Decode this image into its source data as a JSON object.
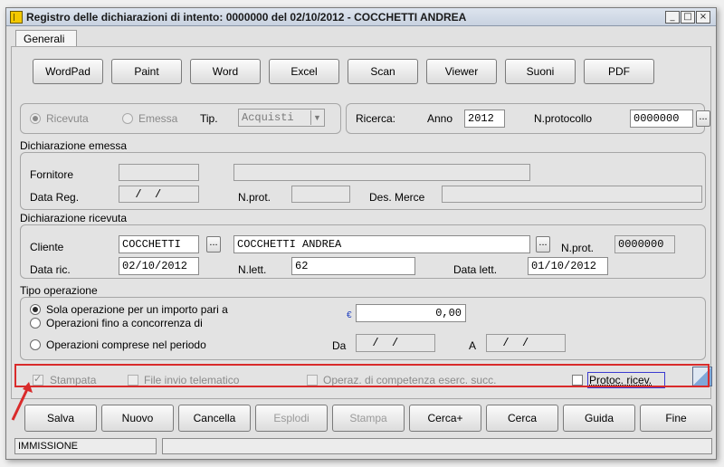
{
  "window": {
    "title": "Registro delle dichiarazioni di intento:  0000000 del 02/10/2012 - COCCHETTI ANDREA",
    "minimize": "_",
    "maximize": "□",
    "close": "×"
  },
  "tabs": [
    "Generali"
  ],
  "toolbar": {
    "buttons": [
      "WordPad",
      "Paint",
      "Word",
      "Excel",
      "Scan",
      "Viewer",
      "Suoni",
      "PDF"
    ]
  },
  "type_section": {
    "ricevuta_label": "Ricevuta",
    "emessa_label": "Emessa",
    "tip_label": "Tip.",
    "tip_value": "Acquisti",
    "ricevuta_selected": true
  },
  "search": {
    "label": "Ricerca:",
    "anno_label": "Anno",
    "anno_value": "2012",
    "protocollo_label": "N.protocollo",
    "protocollo_value": "0000000",
    "browse": "..."
  },
  "emessa": {
    "heading": "Dichiarazione emessa",
    "fornitore_label": "Fornitore",
    "fornitore_code": "",
    "fornitore_name": "",
    "data_reg_label": "Data Reg.",
    "data_reg_value": "  /  /",
    "nprot_label": "N.prot.",
    "nprot_value": "",
    "des_merce_label": "Des. Merce",
    "des_merce_value": ""
  },
  "ricevuta": {
    "heading": "Dichiarazione ricevuta",
    "cliente_label": "Cliente",
    "cliente_code": "COCCHETTI",
    "cliente_name": "COCCHETTI ANDREA",
    "browse": "...",
    "nprot_label": "N.prot.",
    "nprot_value": "0000000",
    "data_ric_label": "Data ric.",
    "data_ric_value": "02/10/2012",
    "nlett_label": "N.lett.",
    "nlett_value": "62",
    "data_lett_label": "Data lett.",
    "data_lett_value": "01/10/2012"
  },
  "operazione": {
    "heading": "Tipo operazione",
    "opt1": "Sola operazione per un importo pari a",
    "opt2": "Operazioni fino a concorrenza di",
    "opt3": "Operazioni comprese nel periodo",
    "selected": "opt1",
    "currency": "€",
    "importo": "0,00",
    "da_label": "Da",
    "da_value": "  /  /",
    "a_label": "A",
    "a_value": "  /  /"
  },
  "flags": {
    "stampata": "Stampata",
    "stampata_checked": true,
    "file_invio": "File invio telematico",
    "operaz": "Operaz. di competenza eserc. succ.",
    "protoc": "Protoc. ricev."
  },
  "actions": [
    {
      "label": "Salva",
      "enabled": true
    },
    {
      "label": "Nuovo",
      "enabled": true
    },
    {
      "label": "Cancella",
      "enabled": true
    },
    {
      "label": "Esplodi",
      "enabled": false
    },
    {
      "label": "Stampa",
      "enabled": false
    },
    {
      "label": "Cerca+",
      "enabled": true
    },
    {
      "label": "Cerca",
      "enabled": true
    },
    {
      "label": "Guida",
      "enabled": true
    },
    {
      "label": "Fine",
      "enabled": true
    }
  ],
  "status": {
    "mode": "IMMISSIONE",
    "message": ""
  },
  "colors": {
    "highlight": "#d92b2b",
    "protoc_border": "#3a3ad0",
    "currency": "#1f3fbf"
  }
}
